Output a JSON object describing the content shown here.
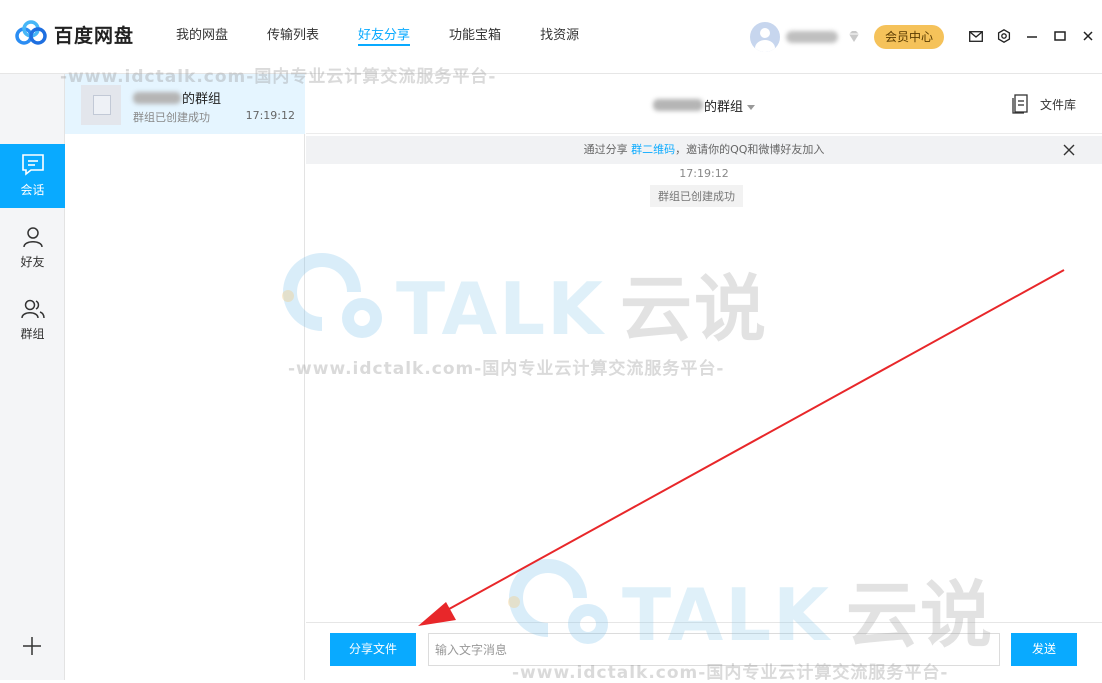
{
  "app": {
    "name": "百度网盘"
  },
  "nav": {
    "tabs": [
      {
        "label": "我的网盘"
      },
      {
        "label": "传输列表"
      },
      {
        "label": "好友分享",
        "active": true
      },
      {
        "label": "功能宝箱"
      },
      {
        "label": "找资源"
      }
    ]
  },
  "header": {
    "member_center": "会员中心"
  },
  "leftbar": {
    "items": [
      {
        "label": "会话",
        "icon": "chat-icon",
        "active": true
      },
      {
        "label": "好友",
        "icon": "person-icon"
      },
      {
        "label": "群组",
        "icon": "group-icon"
      }
    ]
  },
  "conversations": [
    {
      "name_suffix": "的群组",
      "subtitle": "群组已创建成功",
      "time": "17:19:12",
      "selected": true
    }
  ],
  "chat": {
    "title_suffix": "的群组",
    "file_library": "文件库",
    "notice": {
      "prefix": "通过分享 ",
      "link": "群二维码",
      "suffix": "，邀请你的QQ和微博好友加入"
    },
    "messages": [
      {
        "type": "time",
        "text": "17:19:12"
      },
      {
        "type": "system",
        "text": "群组已创建成功"
      }
    ],
    "share_button": "分享文件",
    "input_placeholder": "输入文字消息",
    "send_button": "发送"
  },
  "watermark": {
    "url": "-www.idctalk.com-国内专业云计算交流服务平台-",
    "brand": "TALK",
    "brand_cn": "云说"
  },
  "colors": {
    "accent": "#09aaff",
    "member": "#f5c25a",
    "arrow": "#e8272a"
  }
}
